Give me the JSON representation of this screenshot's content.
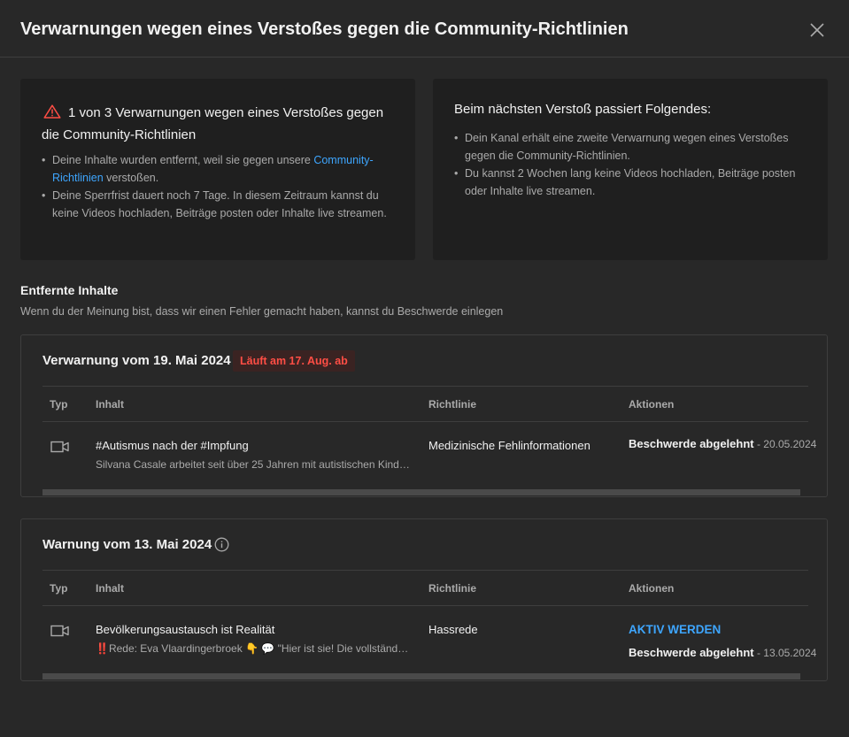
{
  "header": {
    "title": "Verwarnungen wegen eines Verstoßes gegen die Community-Richtlinien",
    "close_icon": "close-icon"
  },
  "current_strike": {
    "icon": "warning-triangle-icon",
    "heading": "1 von 3 Verwarnungen wegen eines Verstoßes gegen die Community-Richtlinien",
    "bullet1_prefix": "Deine Inhalte wurden entfernt, weil sie gegen unsere ",
    "bullet1_link": "Community-Richtlinien",
    "bullet1_suffix": " verstoßen.",
    "bullet2": "Deine Sperrfrist dauert noch 7 Tage. In diesem Zeitraum kannst du keine Videos hochladen, Beiträge posten oder Inhalte live streamen."
  },
  "next_violation": {
    "heading": "Beim nächsten Verstoß passiert Folgendes:",
    "bullet1": "Dein Kanal erhält eine zweite Verwarnung wegen eines Verstoßes gegen die Community-Richtlinien.",
    "bullet2": "Du kannst 2 Wochen lang keine Videos hochladen, Beiträge posten oder Inhalte live streamen."
  },
  "removed": {
    "title": "Entfernte Inhalte",
    "subtitle": "Wenn du der Meinung bist, dass wir einen Fehler gemacht haben, kannst du Beschwerde einlegen"
  },
  "columns": {
    "typ": "Typ",
    "inhalt": "Inhalt",
    "richtlinie": "Richtlinie",
    "aktionen": "Aktionen"
  },
  "strikes": [
    {
      "title": "Verwarnung vom 19. Mai 2024",
      "badge": "Läuft am 17. Aug. ab",
      "type_icon": "video-camera-icon",
      "content_title": "#Autismus nach der #Impfung",
      "content_desc": "Silvana Casale arbeitet seit über 25 Jahren mit autistischen Kindern und Erwachsenen",
      "policy": "Medizinische Fehlinformationen",
      "action_status": "Beschwerde abgelehnt",
      "action_date": " - 20.05.2024"
    },
    {
      "title": "Warnung vom 13. Mai 2024",
      "info_icon": "info-icon",
      "type_icon": "video-camera-icon",
      "content_title": "Bevölkerungsaustausch ist Realität",
      "content_desc": "‼️Rede: Eva Vlaardingerbroek 👇 💬 \"Hier ist sie! Die vollständige Rede",
      "policy": "Hassrede",
      "action_button": "AKTIV WERDEN",
      "action_status": "Beschwerde abgelehnt",
      "action_date": " - 13.05.2024"
    }
  ],
  "colors": {
    "background": "#282828",
    "card": "#1f1f1f",
    "link": "#3ea6ff",
    "badge_text": "#ff4e45",
    "warning_icon": "#ff4e45"
  }
}
